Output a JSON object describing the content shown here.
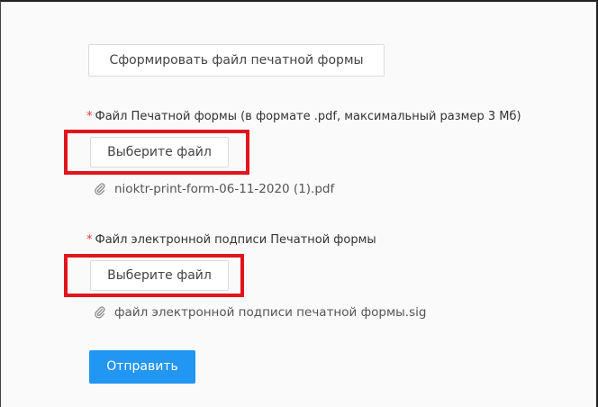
{
  "form": {
    "generate_button_label": "Сформировать файл печатной формы",
    "print_form_field": {
      "required_mark": "*",
      "label": "Файл Печатной формы (в формате .pdf, максимальный размер 3 Мб)",
      "choose_button_label": "Выберите файл",
      "attached_file_name": "nioktr-print-form-06-11-2020 (1).pdf",
      "attachment_icon": "paperclip-icon"
    },
    "signature_field": {
      "required_mark": "*",
      "label": "Файл электронной подписи Печатной формы",
      "choose_button_label": "Выберите файл",
      "attached_file_name": "файл электронной подписи печатной формы.sig",
      "attachment_icon": "paperclip-icon"
    },
    "submit_button_label": "Отправить"
  },
  "colors": {
    "primary_button": "#2196f3",
    "required_mark": "#e53935",
    "highlight_frame": "#e2141c"
  }
}
